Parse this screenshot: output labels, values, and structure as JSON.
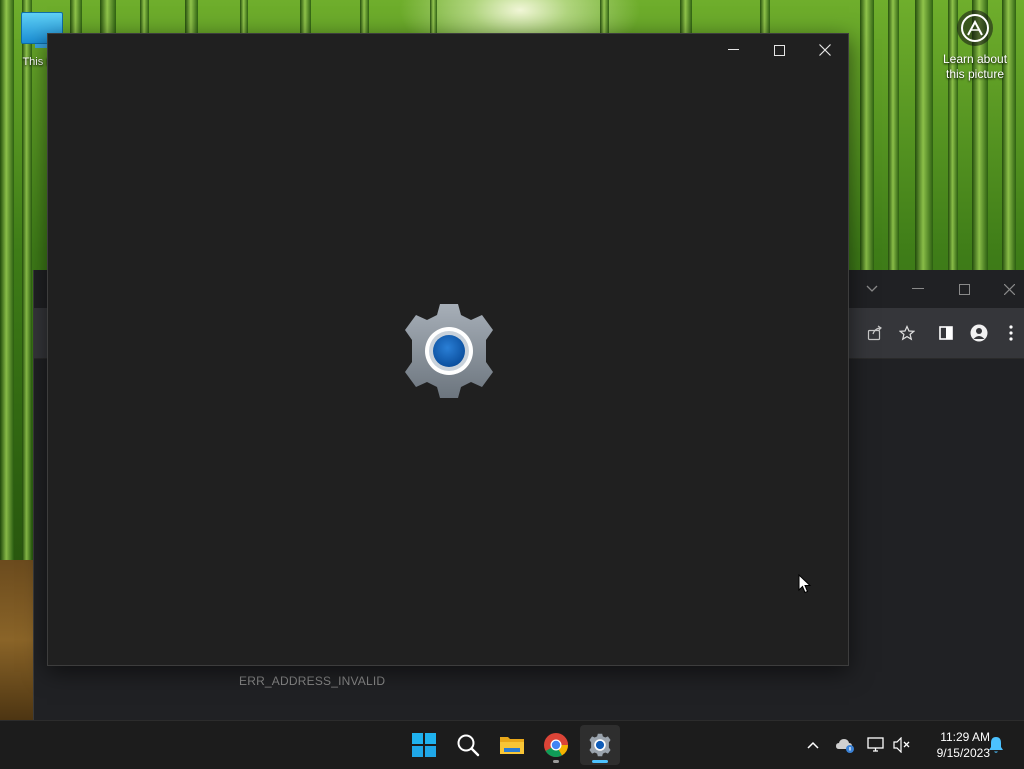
{
  "desktop": {
    "this_pc_label": "This PC",
    "learn_label_line1": "Learn about",
    "learn_label_line2": "this picture"
  },
  "settings_window": {
    "app": "Settings",
    "minimize_icon": "minimize-icon",
    "maximize_icon": "maximize-icon",
    "close_icon": "close-icon",
    "splash_icon": "settings-gear-icon",
    "background": "#202020",
    "accent": "#0f5cb8"
  },
  "browser_window": {
    "error_text": "ERR_ADDRESS_INVALID",
    "toolbar_icons": [
      "share-icon",
      "bookmark-star-icon",
      "side-panel-icon",
      "profile-icon",
      "more-menu-icon"
    ]
  },
  "taskbar": {
    "apps": [
      "start-button",
      "search-button",
      "file-explorer",
      "chrome",
      "settings"
    ],
    "active_app": "settings",
    "time": "11:29 AM",
    "date": "9/15/2023"
  }
}
